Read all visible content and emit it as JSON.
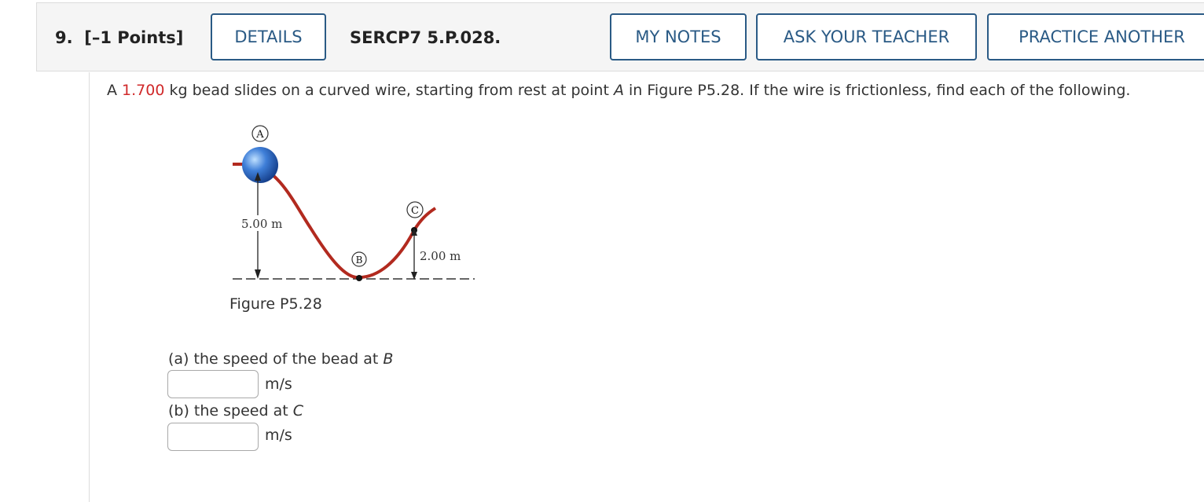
{
  "question": {
    "number": "9.",
    "points": "[–1 Points]",
    "code": "SERCP7 5.P.028."
  },
  "buttons": {
    "details": "DETAILS",
    "my_notes": "MY NOTES",
    "ask_teacher": "ASK YOUR TEACHER",
    "practice": "PRACTICE ANOTHER"
  },
  "problem": {
    "part1": "A ",
    "mass": "1.700",
    "part2": " kg bead slides on a curved wire, starting from rest at point ",
    "pointA": "A",
    "part3": " in Figure P5.28. If the wire is frictionless, find each of the following."
  },
  "figure": {
    "caption": "Figure P5.28",
    "label_a": "A",
    "label_b": "B",
    "label_c": "C",
    "height_a": "5.00 m",
    "height_c": "2.00 m"
  },
  "parts": [
    {
      "prefix": "(a) the speed of the bead at ",
      "var": "B",
      "unit": "m/s",
      "value": ""
    },
    {
      "prefix": "(b) the speed at ",
      "var": "C",
      "unit": "m/s",
      "value": ""
    }
  ],
  "colors": {
    "accent": "#2a5a85",
    "highlight": "#d0292a",
    "wire": "#b22a1f",
    "bead": "#3f7fd8"
  }
}
